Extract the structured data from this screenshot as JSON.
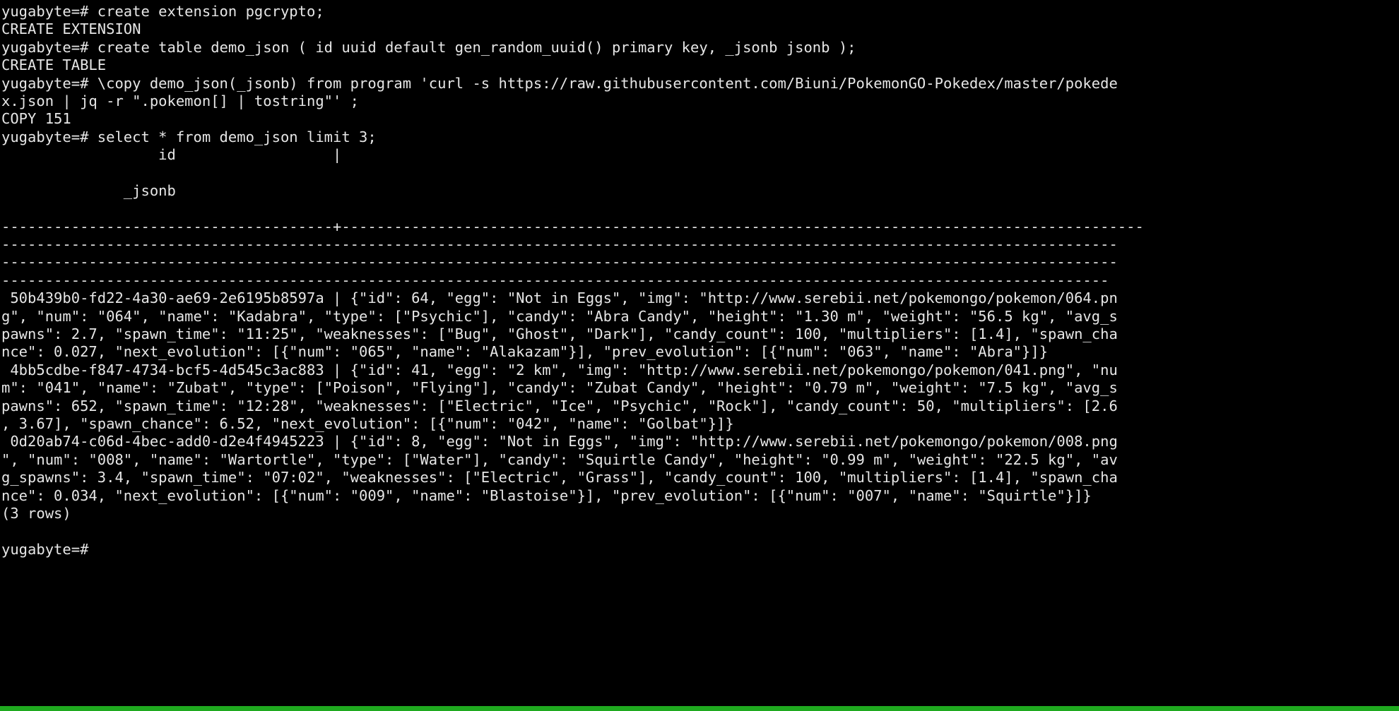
{
  "terminal": {
    "title": "ysqlsh terminal session",
    "prompt": "yugabyte=#",
    "foreground_color": "#e6e6e6",
    "background_color": "#000000",
    "statusbar_color": "#1faa1f",
    "columns": 96,
    "rows": 39
  },
  "session": {
    "commands": [
      "create extension pgcrypto;",
      "create table demo_json ( id uuid default gen_random_uuid() primary key, _jsonb jsonb );",
      "\\copy demo_json(_jsonb) from program 'curl -s https://raw.githubusercontent.com/Biuni/PokemonGO-Pokedex/master/pokedex.json | jq -r \".pokemon[] | tostring\"' ;",
      "select * from demo_json limit 3;"
    ],
    "responses": [
      "CREATE EXTENSION",
      "CREATE TABLE",
      "COPY 151",
      "(3 rows)"
    ],
    "row_count_label": "(3 rows)",
    "copy_count_label": "COPY 151"
  },
  "result_table": {
    "columns": [
      "id",
      "_jsonb"
    ],
    "separator_segment_1": "--------------------------------------",
    "separator_plus": "+",
    "rows": [
      {
        "id": "50b439b0-fd22-4a30-ae69-2e6195b8597a",
        "jsonb": "{\"id\": 64, \"egg\": \"Not in Eggs\", \"img\": \"http://www.serebii.net/pokemongo/pokemon/064.png\", \"num\": \"064\", \"name\": \"Kadabra\", \"type\": [\"Psychic\"], \"candy\": \"Abra Candy\", \"height\": \"1.30 m\", \"weight\": \"56.5 kg\", \"avg_spawns\": 2.7, \"spawn_time\": \"11:25\", \"weaknesses\": [\"Bug\", \"Ghost\", \"Dark\"], \"candy_count\": 100, \"multipliers\": [1.4], \"spawn_chance\": 0.027, \"next_evolution\": [{\"num\": \"065\", \"name\": \"Alakazam\"}], \"prev_evolution\": [{\"num\": \"063\", \"name\": \"Abra\"}]}"
      },
      {
        "id": "4bb5cdbe-f847-4734-bcf5-4d545c3ac883",
        "jsonb": "{\"id\": 41, \"egg\": \"2 km\", \"img\": \"http://www.serebii.net/pokemongo/pokemon/041.png\", \"num\": \"041\", \"name\": \"Zubat\", \"type\": [\"Poison\", \"Flying\"], \"candy\": \"Zubat Candy\", \"height\": \"0.79 m\", \"weight\": \"7.5 kg\", \"avg_spawns\": 652, \"spawn_time\": \"12:28\", \"weaknesses\": [\"Electric\", \"Ice\", \"Psychic\", \"Rock\"], \"candy_count\": 50, \"multipliers\": [2.6, 3.67], \"spawn_chance\": 6.52, \"next_evolution\": [{\"num\": \"042\", \"name\": \"Golbat\"}]}"
      },
      {
        "id": "0d20ab74-c06d-4bec-add0-d2e4f4945223",
        "jsonb": "{\"id\": 8, \"egg\": \"Not in Eggs\", \"img\": \"http://www.serebii.net/pokemongo/pokemon/008.png\", \"num\": \"008\", \"name\": \"Wartortle\", \"type\": [\"Water\"], \"candy\": \"Squirtle Candy\", \"height\": \"0.99 m\", \"weight\": \"22.5 kg\", \"avg_spawns\": 3.4, \"spawn_time\": \"07:02\", \"weaknesses\": [\"Electric\", \"Grass\"], \"candy_count\": 100, \"multipliers\": [1.4], \"spawn_chance\": 0.034, \"next_evolution\": [{\"num\": \"009\", \"name\": \"Blastoise\"}], \"prev_evolution\": [{\"num\": \"007\", \"name\": \"Squirtle\"}]}"
      }
    ]
  },
  "screen_lines": [
    "yugabyte=# create extension pgcrypto;",
    "CREATE EXTENSION",
    "yugabyte=# create table demo_json ( id uuid default gen_random_uuid() primary key, _jsonb jsonb );",
    "CREATE TABLE",
    "yugabyte=# \\copy demo_json(_jsonb) from program 'curl -s https://raw.githubusercontent.com/Biuni/PokemonGO-Pokedex/master/pokede",
    "x.json | jq -r \".pokemon[] | tostring\"' ;",
    "COPY 151",
    "yugabyte=# select * from demo_json limit 3;",
    "                  id                  |",
    "",
    "              _jsonb",
    "",
    "--------------------------------------+--------------------------------------------------------------------------------------------",
    "--------------------------------------------------------------------------------------------------------------------------------",
    "--------------------------------------------------------------------------------------------------------------------------------",
    "-------------------------------------------------------------------------------------------------------------------------------",
    " 50b439b0-fd22-4a30-ae69-2e6195b8597a | {\"id\": 64, \"egg\": \"Not in Eggs\", \"img\": \"http://www.serebii.net/pokemongo/pokemon/064.pn",
    "g\", \"num\": \"064\", \"name\": \"Kadabra\", \"type\": [\"Psychic\"], \"candy\": \"Abra Candy\", \"height\": \"1.30 m\", \"weight\": \"56.5 kg\", \"avg_s",
    "pawns\": 2.7, \"spawn_time\": \"11:25\", \"weaknesses\": [\"Bug\", \"Ghost\", \"Dark\"], \"candy_count\": 100, \"multipliers\": [1.4], \"spawn_cha",
    "nce\": 0.027, \"next_evolution\": [{\"num\": \"065\", \"name\": \"Alakazam\"}], \"prev_evolution\": [{\"num\": \"063\", \"name\": \"Abra\"}]}",
    " 4bb5cdbe-f847-4734-bcf5-4d545c3ac883 | {\"id\": 41, \"egg\": \"2 km\", \"img\": \"http://www.serebii.net/pokemongo/pokemon/041.png\", \"nu",
    "m\": \"041\", \"name\": \"Zubat\", \"type\": [\"Poison\", \"Flying\"], \"candy\": \"Zubat Candy\", \"height\": \"0.79 m\", \"weight\": \"7.5 kg\", \"avg_s",
    "pawns\": 652, \"spawn_time\": \"12:28\", \"weaknesses\": [\"Electric\", \"Ice\", \"Psychic\", \"Rock\"], \"candy_count\": 50, \"multipliers\": [2.6",
    ", 3.67], \"spawn_chance\": 6.52, \"next_evolution\": [{\"num\": \"042\", \"name\": \"Golbat\"}]}",
    " 0d20ab74-c06d-4bec-add0-d2e4f4945223 | {\"id\": 8, \"egg\": \"Not in Eggs\", \"img\": \"http://www.serebii.net/pokemongo/pokemon/008.png",
    "\", \"num\": \"008\", \"name\": \"Wartortle\", \"type\": [\"Water\"], \"candy\": \"Squirtle Candy\", \"height\": \"0.99 m\", \"weight\": \"22.5 kg\", \"av",
    "g_spawns\": 3.4, \"spawn_time\": \"07:02\", \"weaknesses\": [\"Electric\", \"Grass\"], \"candy_count\": 100, \"multipliers\": [1.4], \"spawn_cha",
    "nce\": 0.034, \"next_evolution\": [{\"num\": \"009\", \"name\": \"Blastoise\"}], \"prev_evolution\": [{\"num\": \"007\", \"name\": \"Squirtle\"}]}",
    "(3 rows)",
    "",
    "yugabyte=#"
  ]
}
